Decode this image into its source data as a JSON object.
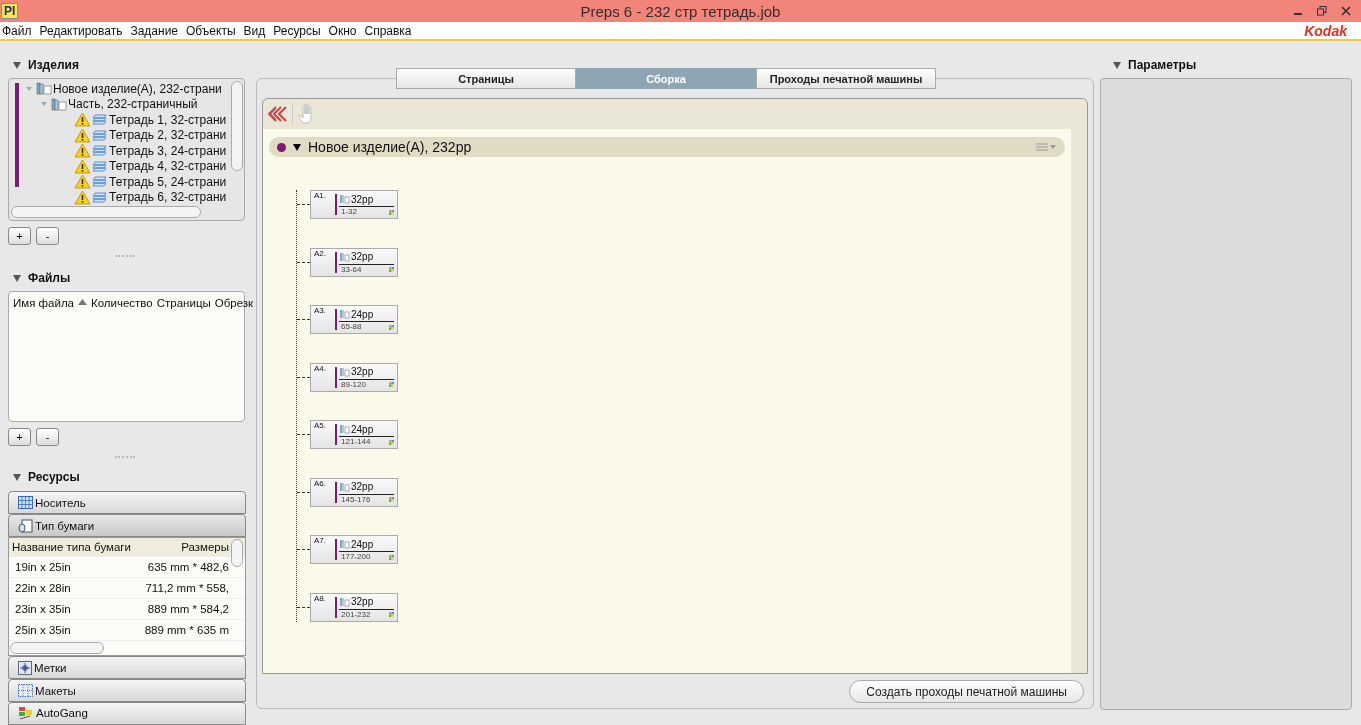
{
  "window": {
    "app_icon": "PI",
    "title": "Preps 6 - 232 стр тетрадь.job",
    "logo": "Kodak"
  },
  "menu": [
    "Файл",
    "Редактировать",
    "Задание",
    "Объекты",
    "Вид",
    "Ресурсы",
    "Окно",
    "Справка"
  ],
  "products_panel": {
    "title": "Изделия",
    "expanded": true,
    "tree": [
      {
        "kind": "product",
        "label": "Новое изделие(А), 232-страни",
        "expanded": true,
        "children": [
          {
            "kind": "part",
            "label": "Часть, 232-страничный",
            "expanded": true,
            "children": [
              {
                "kind": "signature",
                "label": "Тетрадь 1, 32-страни",
                "warning": true
              },
              {
                "kind": "signature",
                "label": "Тетрадь 2, 32-страни",
                "warning": true
              },
              {
                "kind": "signature",
                "label": "Тетрадь 3, 24-страни",
                "warning": true
              },
              {
                "kind": "signature",
                "label": "Тетрадь 4, 32-страни",
                "warning": true
              },
              {
                "kind": "signature",
                "label": "Тетрадь 5, 24-страни",
                "warning": true
              },
              {
                "kind": "signature",
                "label": "Тетрадь 6, 32-страни",
                "warning": true
              }
            ]
          }
        ]
      }
    ],
    "buttons": [
      "+",
      "-"
    ]
  },
  "files_panel": {
    "title": "Файлы",
    "expanded": true,
    "columns": [
      {
        "label": "Имя файла",
        "sorted": true
      },
      {
        "label": "Количество",
        "sorted": false
      },
      {
        "label": "Страницы",
        "sorted": false
      },
      {
        "label": "Обрезк",
        "sorted": false
      }
    ],
    "buttons": [
      "+",
      "-"
    ]
  },
  "resources_panel": {
    "title": "Ресурсы",
    "expanded": true,
    "sections": [
      {
        "kind": "media",
        "label": "Носитель",
        "expanded": false
      },
      {
        "kind": "paper",
        "label": "Тип бумаги",
        "expanded": true,
        "table": {
          "columns": [
            "Название типа бумаги",
            "Размеры"
          ],
          "rows": [
            [
              "19in x 25in",
              "635 mm * 482,6"
            ],
            [
              "22in x 28in",
              "711,2 mm * 558,"
            ],
            [
              "23in x 35in",
              "889 mm * 584,2"
            ],
            [
              "25in x 35in",
              "889 mm * 635 m"
            ]
          ]
        }
      },
      {
        "kind": "marks",
        "label": "Метки",
        "expanded": false
      },
      {
        "kind": "layouts",
        "label": "Макеты",
        "expanded": false
      },
      {
        "kind": "autogang",
        "label": "AutoGang",
        "expanded": false
      }
    ]
  },
  "center": {
    "tabs": [
      {
        "label": "Страницы",
        "selected": false
      },
      {
        "label": "Сборка",
        "selected": true
      },
      {
        "label": "Проходы печатной машины",
        "selected": false
      }
    ],
    "product": {
      "label": "Новое изделие(А), 232pp",
      "color": "#7b1a6e",
      "expanded": true
    },
    "signatures": [
      {
        "label": "A1.",
        "pages": "32pp",
        "range": "1-32"
      },
      {
        "label": "A2.",
        "pages": "32pp",
        "range": "33-64"
      },
      {
        "label": "A3.",
        "pages": "24pp",
        "range": "65-88"
      },
      {
        "label": "A4.",
        "pages": "32pp",
        "range": "89-120"
      },
      {
        "label": "A5.",
        "pages": "24pp",
        "range": "121-144"
      },
      {
        "label": "A6.",
        "pages": "32pp",
        "range": "145-176"
      },
      {
        "label": "A7.",
        "pages": "24pp",
        "range": "177-200"
      },
      {
        "label": "A8.",
        "pages": "32pp",
        "range": "201-232"
      }
    ],
    "button": "Создать проходы печатной машины"
  },
  "params_panel": {
    "title": "Параметры",
    "expanded": true
  }
}
